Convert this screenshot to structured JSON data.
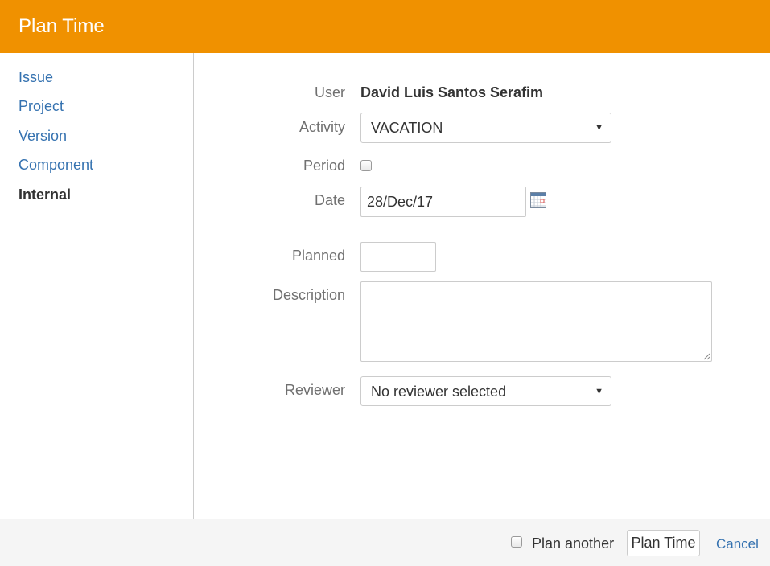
{
  "dialog": {
    "title": "Plan Time"
  },
  "sidebar": {
    "items": [
      {
        "label": "Issue",
        "active": false
      },
      {
        "label": "Project",
        "active": false
      },
      {
        "label": "Version",
        "active": false
      },
      {
        "label": "Component",
        "active": false
      },
      {
        "label": "Internal",
        "active": true
      }
    ]
  },
  "form": {
    "user": {
      "label": "User",
      "value": "David Luis Santos Serafim"
    },
    "activity": {
      "label": "Activity",
      "selected": "VACATION"
    },
    "period": {
      "label": "Period",
      "checked": false
    },
    "date": {
      "label": "Date",
      "value": "28/Dec/17",
      "icon": "calendar-icon"
    },
    "planned": {
      "label": "Planned",
      "value": ""
    },
    "description": {
      "label": "Description",
      "value": ""
    },
    "reviewer": {
      "label": "Reviewer",
      "selected": "No reviewer selected"
    }
  },
  "footer": {
    "plan_another_label": "Plan another",
    "plan_another_checked": false,
    "submit_label": "Plan Time",
    "cancel_label": "Cancel"
  },
  "colors": {
    "header_bg": "#f09100",
    "link": "#3572b0",
    "footer_bg": "#f5f5f5"
  }
}
